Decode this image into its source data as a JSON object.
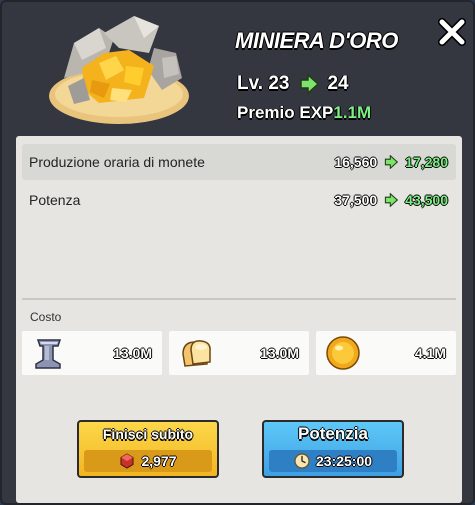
{
  "building": {
    "title": "MINIERA D'ORO",
    "icon": "gold-mine-icon"
  },
  "level": {
    "prefix": "Lv.",
    "current": "23",
    "next": "24"
  },
  "exp": {
    "label": "Premio EXP",
    "value": "1.1M"
  },
  "stats": [
    {
      "label": "Produzione oraria di monete",
      "old": "16,560",
      "new": "17,280"
    },
    {
      "label": "Potenza",
      "old": "37,500",
      "new": "43,500"
    }
  ],
  "cost": {
    "label": "Costo",
    "items": [
      {
        "icon": "iron-anvil-icon",
        "amount": "13.0M"
      },
      {
        "icon": "bread-icon",
        "amount": "13.0M"
      },
      {
        "icon": "gold-coin-icon",
        "amount": "4.1M"
      }
    ]
  },
  "buttons": {
    "finish": {
      "label": "Finisci subito",
      "icon": "gem-icon",
      "value": "2,977"
    },
    "upgrade": {
      "label": "Potenzia",
      "icon": "clock-icon",
      "value": "23:25:00"
    }
  },
  "colors": {
    "accent_green": "#7cf083",
    "yellow_button": "#f2b522",
    "blue_button": "#3ea0e4",
    "panel": "#343640",
    "body": "#e6e5e1"
  }
}
